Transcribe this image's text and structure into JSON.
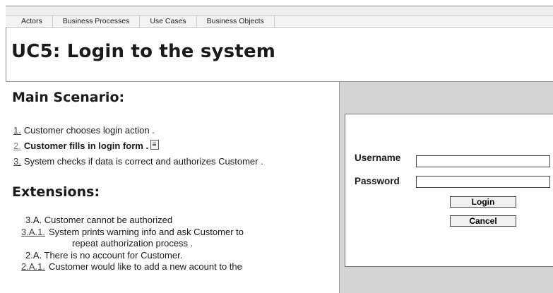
{
  "tabs": [
    "Actors",
    "Business Processes",
    "Use Cases",
    "Business Objects"
  ],
  "title": "UC5: Login to the system",
  "main_scenario": {
    "heading": "Main Scenario:",
    "steps": [
      {
        "num": "1.",
        "text": "Customer chooses login action ."
      },
      {
        "num": "2.",
        "text": "Customer fills in login form ."
      },
      {
        "num": "3.",
        "text": "System checks if data is correct and authorizes Customer ."
      }
    ]
  },
  "extensions": {
    "heading": "Extensions:",
    "lines": [
      {
        "num": "",
        "text": "3.A. Customer cannot be authorized"
      },
      {
        "num": "3.A.1.",
        "text": "System prints warning info and ask Customer to"
      },
      {
        "num": "",
        "text": "repeat authorization process ."
      },
      {
        "num": "",
        "text": "2.A. There is no account for Customer."
      },
      {
        "num": "2.A.1.",
        "text": "Customer would like to add a new acount to the"
      }
    ]
  },
  "login_form": {
    "username_label": "Username",
    "password_label": "Password",
    "username_value": "",
    "password_value": "",
    "login_button": "Login",
    "cancel_button": "Cancel"
  },
  "icons": {
    "step_2_attachment": "document-icon"
  }
}
